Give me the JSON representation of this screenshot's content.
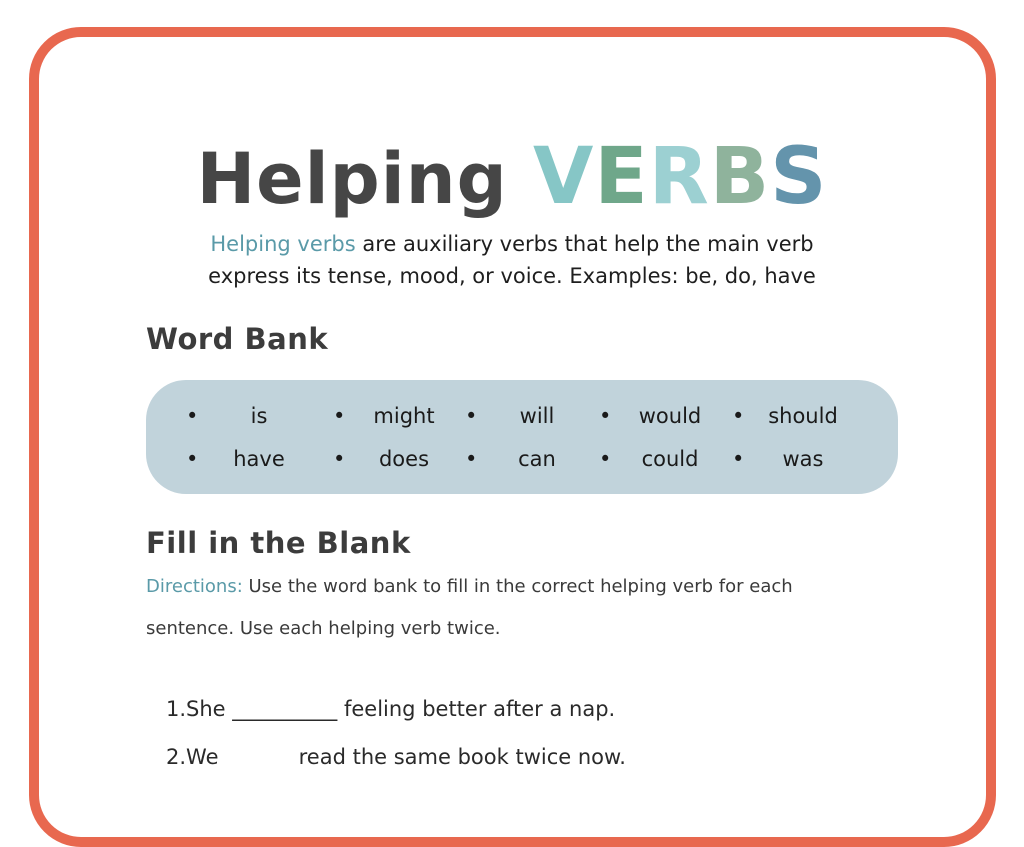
{
  "worksheet": {
    "title_part1": "Helping ",
    "title_part2_letters": [
      {
        "char": "V",
        "color": "#86c6c6"
      },
      {
        "char": "E",
        "color": "#6fa78a"
      },
      {
        "char": "R",
        "color": "#9cd0d2"
      },
      {
        "char": "B",
        "color": "#8fb39c"
      },
      {
        "char": "S",
        "color": "#6494ac"
      }
    ],
    "intro_highlight": "Helping verbs",
    "intro_line1_rest": " are auxiliary verbs that help the main verb",
    "intro_line2": "express its tense, mood, or voice. Examples: be, do, have",
    "accent_color": "#5a9aa8",
    "border_color": "#e8684f",
    "word_bank_heading": "Word Bank",
    "word_bank_bullet": "•",
    "word_bank_rows": [
      [
        "is",
        "might",
        "will",
        "would",
        "should"
      ],
      [
        "have",
        "does",
        "can",
        "could",
        "was"
      ]
    ],
    "fill_heading": "Fill in the Blank",
    "directions_label": "Directions:",
    "directions_text": " Use the word bank to fill in the correct helping verb for each sentence. Use each helping verb twice.",
    "questions": [
      {
        "number": "1.",
        "before": "She ",
        "blank": "__________",
        "after": " feeling better after a nap."
      },
      {
        "number": "2.",
        "before": "We ",
        "blank": "          ",
        "after": " read the same book twice now."
      }
    ]
  }
}
